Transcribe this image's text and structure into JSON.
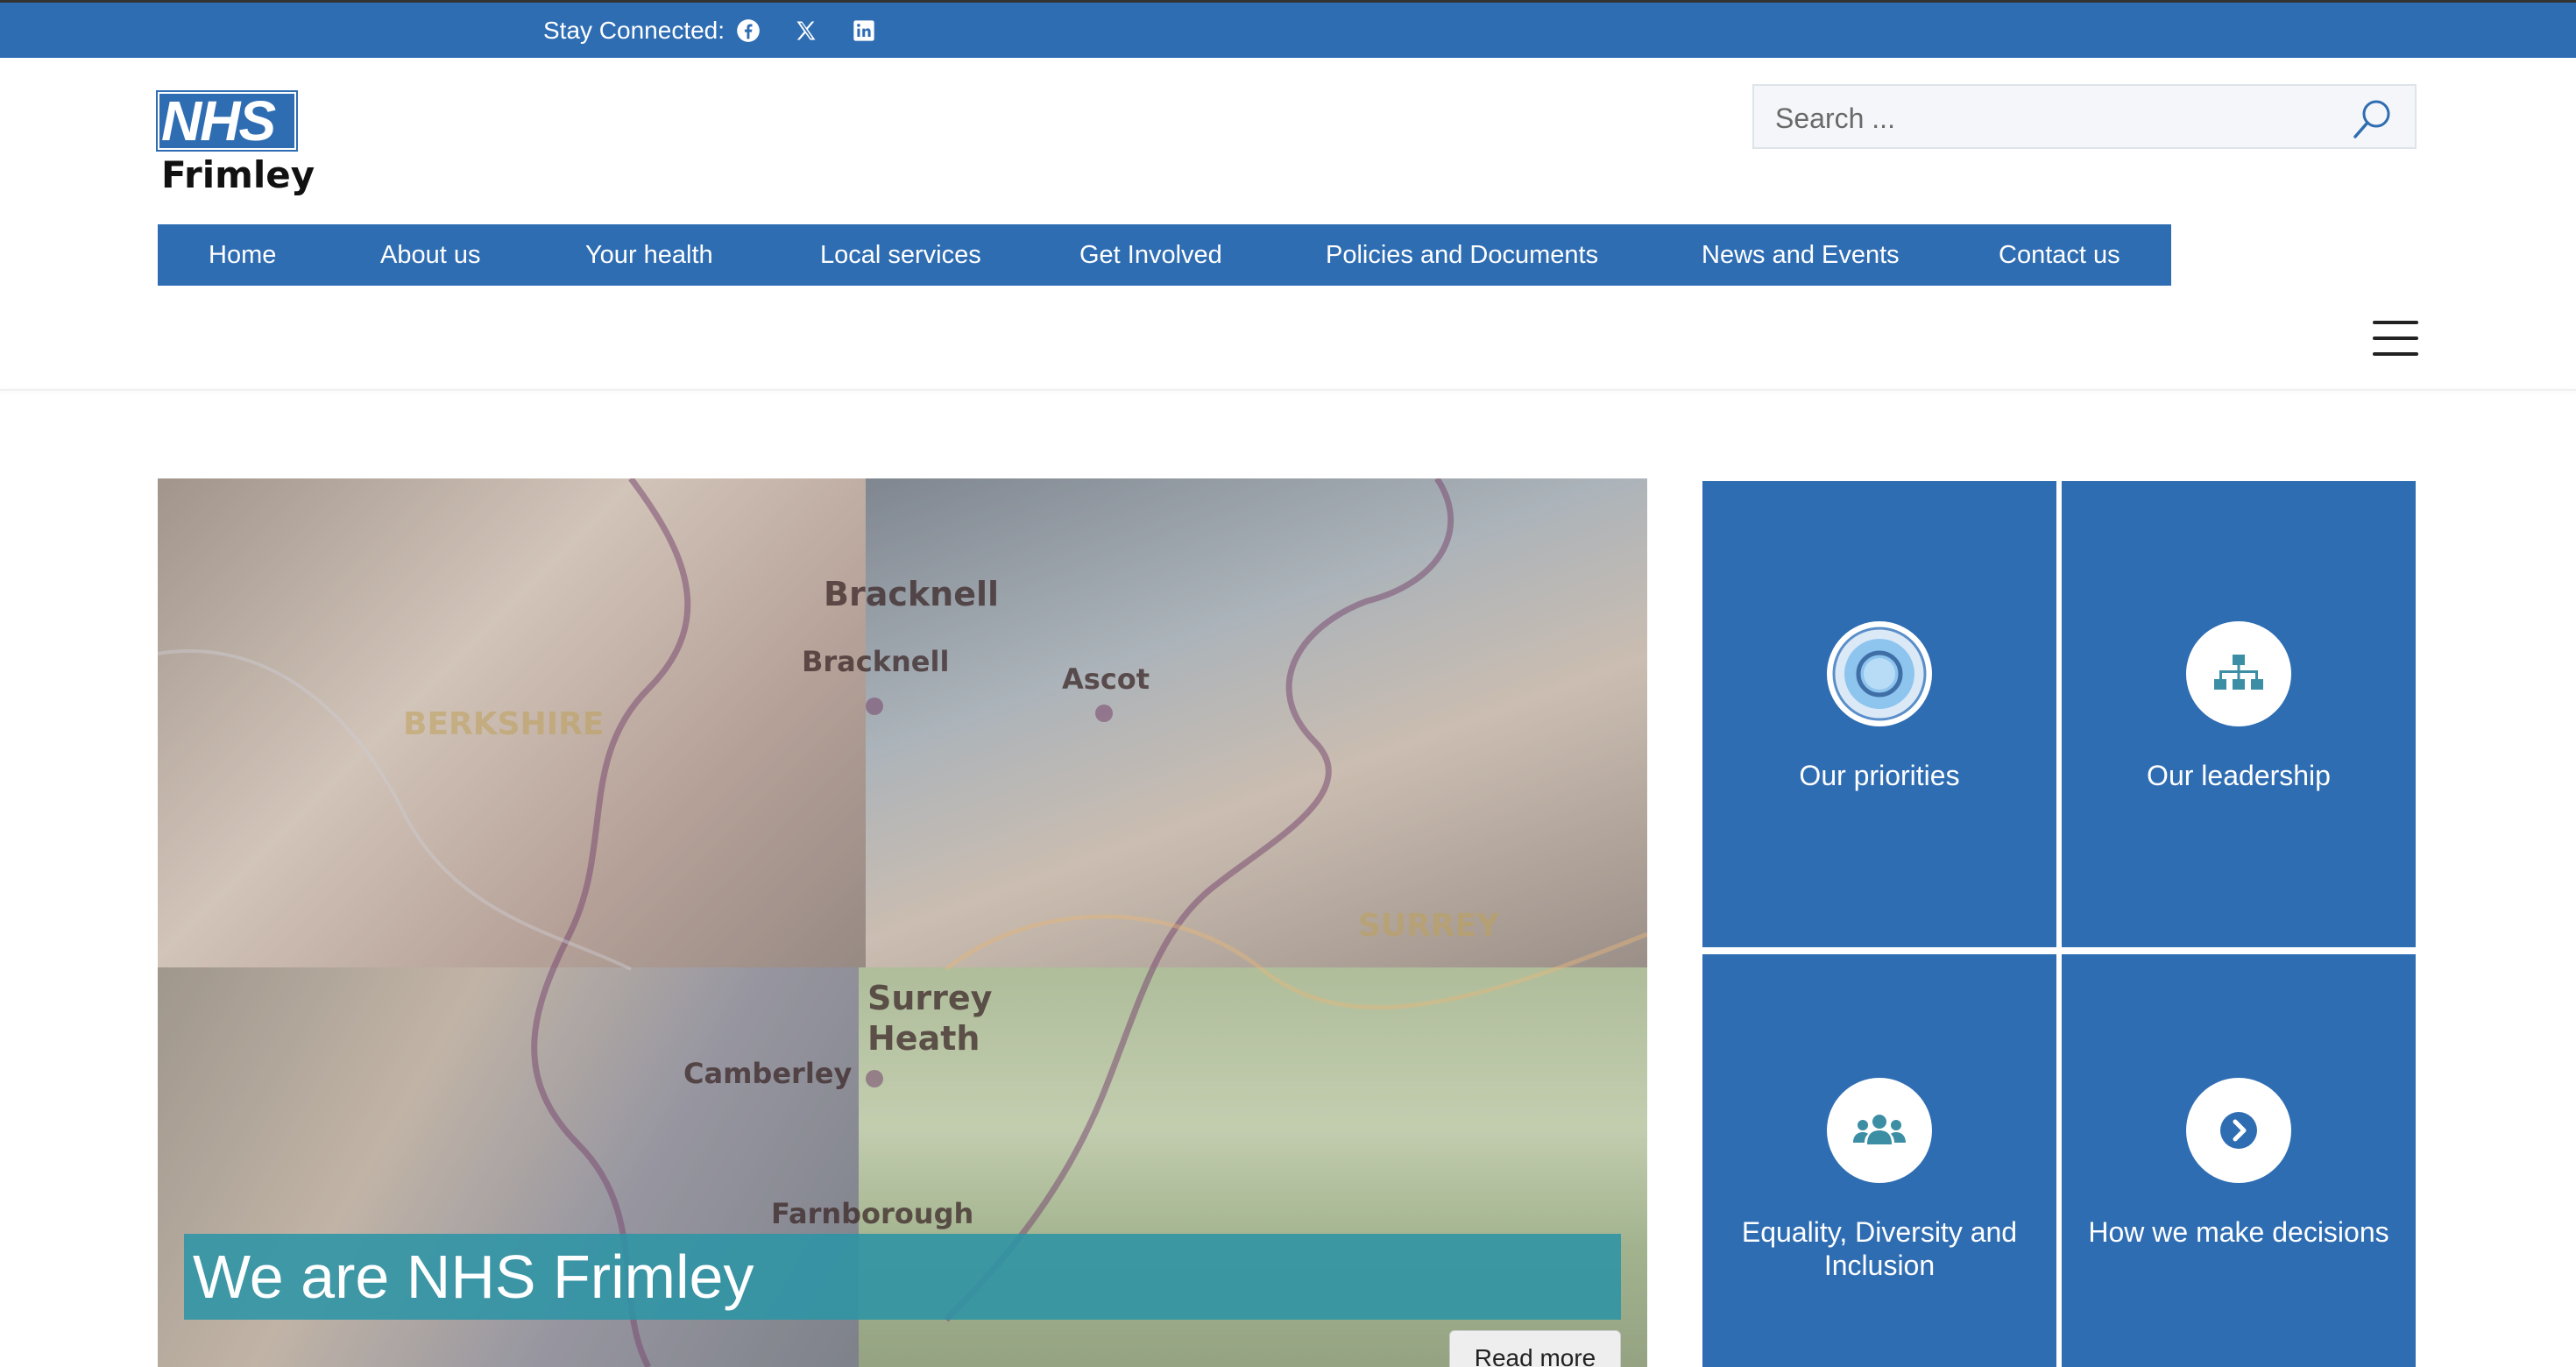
{
  "topbar": {
    "stay_connected": "Stay Connected:"
  },
  "header": {
    "logo_mark": "NHS",
    "logo_name": "Frimley"
  },
  "search": {
    "placeholder": "Search ..."
  },
  "nav": {
    "items": [
      "Home",
      "About us",
      "Your health",
      "Local services",
      "Get Involved",
      "Policies and Documents",
      "News and Events",
      "Contact us"
    ]
  },
  "hero": {
    "map_labels": [
      "Bracknell",
      "Bracknell",
      "Ascot",
      "BERKSHIRE",
      "SURREY",
      "Surrey Heath",
      "Camberley",
      "Farnborough"
    ],
    "title": "We are NHS Frimley",
    "read_more": "Read more"
  },
  "tiles": [
    {
      "label": "Our priorities",
      "icon": "target-icon"
    },
    {
      "label": "Our leadership",
      "icon": "org-chart-icon"
    },
    {
      "label": "Equality, Diversity and Inclusion",
      "icon": "people-icon"
    },
    {
      "label": "How we make decisions",
      "icon": "chevron-right-circle-icon"
    }
  ],
  "colors": {
    "brand_blue": "#2f6db3",
    "teal_banner": "#2c94a5",
    "icon_teal": "#3c8ea5"
  }
}
